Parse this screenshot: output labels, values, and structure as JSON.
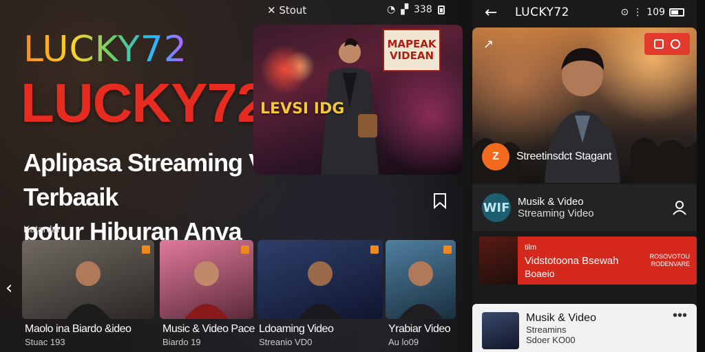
{
  "left": {
    "logo_small": "LUCKY72",
    "logo_big": "LUCKY72",
    "headline_line1": "Aplipasa Streaming Video Terbaaik",
    "headline_line2": "potur Hiburan Anya",
    "section_label": "Katardar",
    "status_left": "✕ Stout",
    "status_time": "338",
    "feature": {
      "overlay": "LEVSI IDG",
      "badge_line1": "MAPEAK",
      "badge_line2": "VIDEAN"
    },
    "thumbnails": [
      {
        "title": "Maolo ina Biardo &ideo",
        "sub": "Stuac 193",
        "colors": [
          "#6f6a62",
          "#2a2622"
        ]
      },
      {
        "title": "Music & Video  Pace",
        "sub": "Biardo 19",
        "colors": [
          "#e07a9a",
          "#5a2a3a"
        ]
      },
      {
        "title": "Ldoaming Video",
        "sub": "Streanio VD0",
        "colors": [
          "#2f3f6a",
          "#0f1530"
        ]
      },
      {
        "title": "Yrabiar Video",
        "sub": "Au lo09",
        "colors": [
          "#4f7fa0",
          "#1a2f3f"
        ]
      }
    ]
  },
  "phone": {
    "title": "LUCKY72",
    "status_time": "109",
    "hero_footer": "Streetinsdct Stagant",
    "channel_title": "Musik & Video",
    "channel_sub": "Streaming Video",
    "channel_avatar": "WIF",
    "banner_line1": "Vidstotoona Bsewah",
    "banner_line2": "Boaeio",
    "banner_small_top": "tilm",
    "banner_right_1": "ROSOVOTOU",
    "banner_right_2": "RODENVARE",
    "bottom_title": "Musik & Video",
    "bottom_line1": "Streamins",
    "bottom_line2": "Sdoer KO00"
  }
}
